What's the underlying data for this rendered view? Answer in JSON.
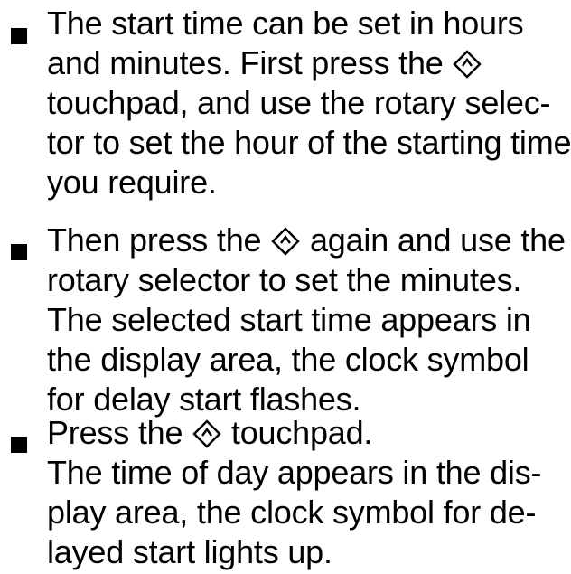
{
  "instructions": [
    {
      "lines": [
        {
          "before": "The start time can be set in hours"
        },
        {
          "before": "and minutes. First press the",
          "icon": "start-touchpad-icon",
          "after": ""
        },
        {
          "before": "touchpad, and use the rotary selec-"
        },
        {
          "before": "tor to set the hour of the starting time"
        },
        {
          "before": "you require."
        }
      ]
    },
    {
      "lines": [
        {
          "before": "Then press the",
          "icon": "start-touchpad-icon",
          "after": "again and use the"
        },
        {
          "before": "rotary selector to set the minutes."
        },
        {
          "before": "The selected start time appears in"
        },
        {
          "before": "the display area, the clock symbol"
        },
        {
          "before": "for delay start flashes."
        }
      ]
    },
    {
      "lines": [
        {
          "before": "Press the",
          "icon": "start-touchpad-icon",
          "after": "touchpad."
        },
        {
          "before": "The time of day appears in the dis-"
        },
        {
          "before": "play area, the clock symbol for de-"
        },
        {
          "before": "layed start lights up."
        }
      ]
    }
  ]
}
